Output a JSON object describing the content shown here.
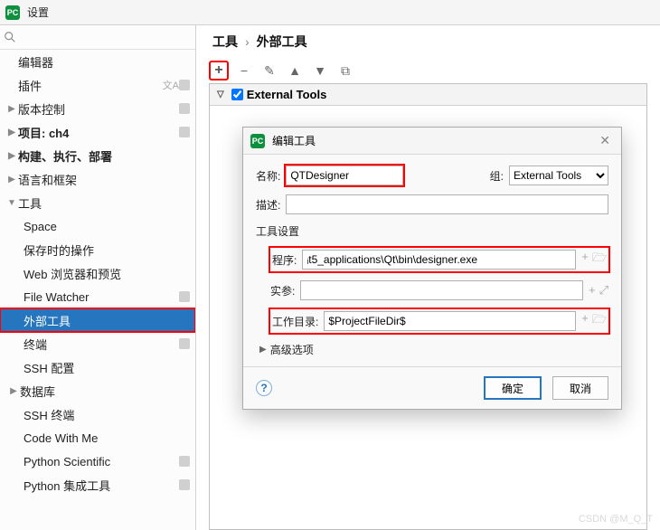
{
  "window": {
    "title": "设置"
  },
  "search": {
    "placeholder": ""
  },
  "sidebar": {
    "items": [
      {
        "label": "编辑器",
        "expandable": false
      },
      {
        "label": "插件",
        "expandable": false,
        "badge": "文A",
        "mod": true
      },
      {
        "label": "版本控制",
        "expandable": true,
        "mod": true
      },
      {
        "label": "项目: ch4",
        "expandable": true,
        "mod": true
      },
      {
        "label": "构建、执行、部署",
        "expandable": true
      },
      {
        "label": "语言和框架",
        "expandable": true
      },
      {
        "label": "工具",
        "expandable": true,
        "expanded": true
      }
    ],
    "tools_children": [
      {
        "label": "Space"
      },
      {
        "label": "保存时的操作"
      },
      {
        "label": "Web 浏览器和预览"
      },
      {
        "label": "File Watcher",
        "mod": true
      },
      {
        "label": "外部工具",
        "selected": true
      },
      {
        "label": "终端",
        "mod": true
      },
      {
        "label": "SSH 配置"
      },
      {
        "label": "数据库",
        "expandable": true
      },
      {
        "label": "SSH 终端"
      },
      {
        "label": "Code With Me"
      },
      {
        "label": "Python Scientific",
        "mod": true
      },
      {
        "label": "Python 集成工具",
        "mod": true
      }
    ]
  },
  "breadcrumb": {
    "part1": "工具",
    "part2": "外部工具"
  },
  "list": {
    "group_header": "External Tools"
  },
  "dialog": {
    "title": "编辑工具",
    "name_label": "名称:",
    "name_value": "QTDesigner",
    "group_label": "组:",
    "group_value": "External Tools",
    "desc_label": "描述:",
    "desc_value": "",
    "section": "工具设置",
    "program_label": "程序:",
    "program_value": "ᵢt5_applications\\Qt\\bin\\designer.exe",
    "args_label": "实参:",
    "args_value": "",
    "workdir_label": "工作目录:",
    "workdir_value": "$ProjectFileDir$",
    "advanced": "高级选项",
    "ok": "确定",
    "cancel": "取消"
  },
  "watermark": "CSDN @M_Q_T"
}
